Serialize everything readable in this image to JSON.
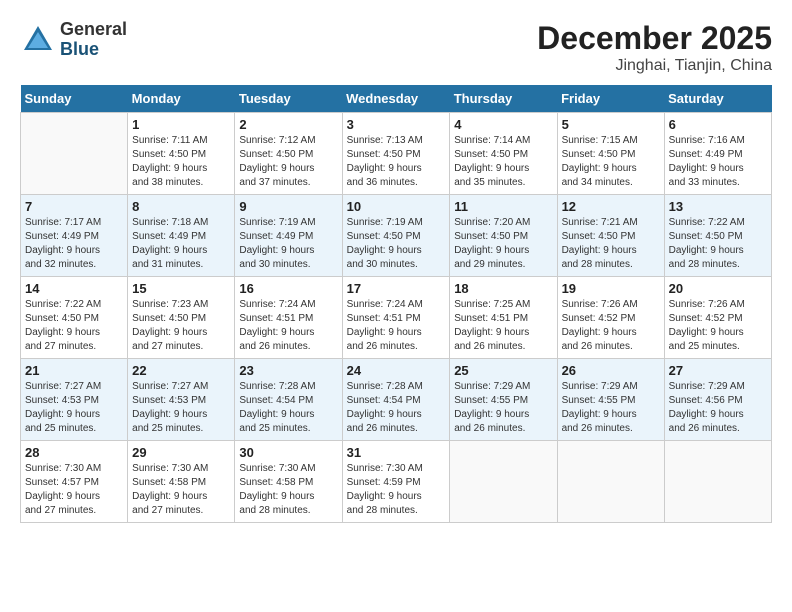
{
  "header": {
    "logo_general": "General",
    "logo_blue": "Blue",
    "title": "December 2025",
    "subtitle": "Jinghai, Tianjin, China"
  },
  "calendar": {
    "days_of_week": [
      "Sunday",
      "Monday",
      "Tuesday",
      "Wednesday",
      "Thursday",
      "Friday",
      "Saturday"
    ],
    "weeks": [
      [
        {
          "day": "",
          "info": ""
        },
        {
          "day": "1",
          "info": "Sunrise: 7:11 AM\nSunset: 4:50 PM\nDaylight: 9 hours\nand 38 minutes."
        },
        {
          "day": "2",
          "info": "Sunrise: 7:12 AM\nSunset: 4:50 PM\nDaylight: 9 hours\nand 37 minutes."
        },
        {
          "day": "3",
          "info": "Sunrise: 7:13 AM\nSunset: 4:50 PM\nDaylight: 9 hours\nand 36 minutes."
        },
        {
          "day": "4",
          "info": "Sunrise: 7:14 AM\nSunset: 4:50 PM\nDaylight: 9 hours\nand 35 minutes."
        },
        {
          "day": "5",
          "info": "Sunrise: 7:15 AM\nSunset: 4:50 PM\nDaylight: 9 hours\nand 34 minutes."
        },
        {
          "day": "6",
          "info": "Sunrise: 7:16 AM\nSunset: 4:49 PM\nDaylight: 9 hours\nand 33 minutes."
        }
      ],
      [
        {
          "day": "7",
          "info": "Sunrise: 7:17 AM\nSunset: 4:49 PM\nDaylight: 9 hours\nand 32 minutes."
        },
        {
          "day": "8",
          "info": "Sunrise: 7:18 AM\nSunset: 4:49 PM\nDaylight: 9 hours\nand 31 minutes."
        },
        {
          "day": "9",
          "info": "Sunrise: 7:19 AM\nSunset: 4:49 PM\nDaylight: 9 hours\nand 30 minutes."
        },
        {
          "day": "10",
          "info": "Sunrise: 7:19 AM\nSunset: 4:50 PM\nDaylight: 9 hours\nand 30 minutes."
        },
        {
          "day": "11",
          "info": "Sunrise: 7:20 AM\nSunset: 4:50 PM\nDaylight: 9 hours\nand 29 minutes."
        },
        {
          "day": "12",
          "info": "Sunrise: 7:21 AM\nSunset: 4:50 PM\nDaylight: 9 hours\nand 28 minutes."
        },
        {
          "day": "13",
          "info": "Sunrise: 7:22 AM\nSunset: 4:50 PM\nDaylight: 9 hours\nand 28 minutes."
        }
      ],
      [
        {
          "day": "14",
          "info": "Sunrise: 7:22 AM\nSunset: 4:50 PM\nDaylight: 9 hours\nand 27 minutes."
        },
        {
          "day": "15",
          "info": "Sunrise: 7:23 AM\nSunset: 4:50 PM\nDaylight: 9 hours\nand 27 minutes."
        },
        {
          "day": "16",
          "info": "Sunrise: 7:24 AM\nSunset: 4:51 PM\nDaylight: 9 hours\nand 26 minutes."
        },
        {
          "day": "17",
          "info": "Sunrise: 7:24 AM\nSunset: 4:51 PM\nDaylight: 9 hours\nand 26 minutes."
        },
        {
          "day": "18",
          "info": "Sunrise: 7:25 AM\nSunset: 4:51 PM\nDaylight: 9 hours\nand 26 minutes."
        },
        {
          "day": "19",
          "info": "Sunrise: 7:26 AM\nSunset: 4:52 PM\nDaylight: 9 hours\nand 26 minutes."
        },
        {
          "day": "20",
          "info": "Sunrise: 7:26 AM\nSunset: 4:52 PM\nDaylight: 9 hours\nand 25 minutes."
        }
      ],
      [
        {
          "day": "21",
          "info": "Sunrise: 7:27 AM\nSunset: 4:53 PM\nDaylight: 9 hours\nand 25 minutes."
        },
        {
          "day": "22",
          "info": "Sunrise: 7:27 AM\nSunset: 4:53 PM\nDaylight: 9 hours\nand 25 minutes."
        },
        {
          "day": "23",
          "info": "Sunrise: 7:28 AM\nSunset: 4:54 PM\nDaylight: 9 hours\nand 25 minutes."
        },
        {
          "day": "24",
          "info": "Sunrise: 7:28 AM\nSunset: 4:54 PM\nDaylight: 9 hours\nand 26 minutes."
        },
        {
          "day": "25",
          "info": "Sunrise: 7:29 AM\nSunset: 4:55 PM\nDaylight: 9 hours\nand 26 minutes."
        },
        {
          "day": "26",
          "info": "Sunrise: 7:29 AM\nSunset: 4:55 PM\nDaylight: 9 hours\nand 26 minutes."
        },
        {
          "day": "27",
          "info": "Sunrise: 7:29 AM\nSunset: 4:56 PM\nDaylight: 9 hours\nand 26 minutes."
        }
      ],
      [
        {
          "day": "28",
          "info": "Sunrise: 7:30 AM\nSunset: 4:57 PM\nDaylight: 9 hours\nand 27 minutes."
        },
        {
          "day": "29",
          "info": "Sunrise: 7:30 AM\nSunset: 4:58 PM\nDaylight: 9 hours\nand 27 minutes."
        },
        {
          "day": "30",
          "info": "Sunrise: 7:30 AM\nSunset: 4:58 PM\nDaylight: 9 hours\nand 28 minutes."
        },
        {
          "day": "31",
          "info": "Sunrise: 7:30 AM\nSunset: 4:59 PM\nDaylight: 9 hours\nand 28 minutes."
        },
        {
          "day": "",
          "info": ""
        },
        {
          "day": "",
          "info": ""
        },
        {
          "day": "",
          "info": ""
        }
      ]
    ]
  }
}
